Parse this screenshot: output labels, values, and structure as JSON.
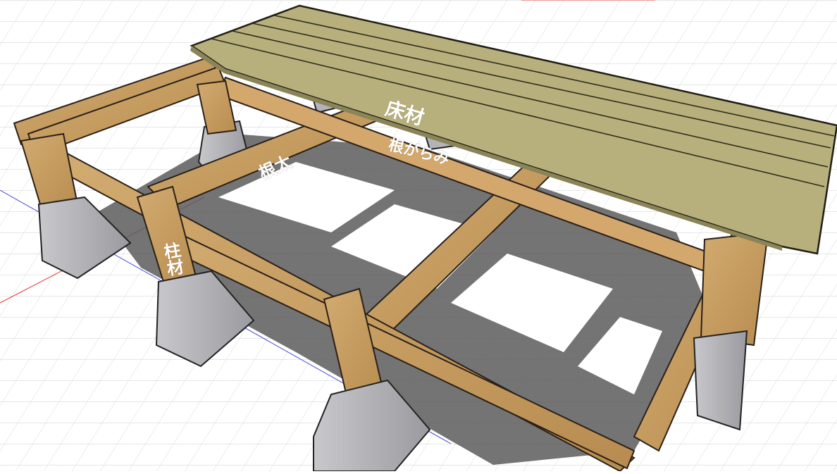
{
  "labels": {
    "floorboard": "床材",
    "joist": "根太",
    "brace": "根がらみ",
    "post": "柱材"
  },
  "colors": {
    "background": "#ffffff",
    "grid": "#d4d4d4",
    "axis_red": "#e33b3b",
    "axis_blue": "#4a4ad8",
    "floor": "#b8b07c",
    "floor_edge": "#2a2a1e",
    "wood": "#c8a064",
    "wood_dark": "#a87e44",
    "concrete": "#b9b9bd",
    "concrete_dark": "#8e8e94",
    "shadow": "#5a5a5a"
  }
}
